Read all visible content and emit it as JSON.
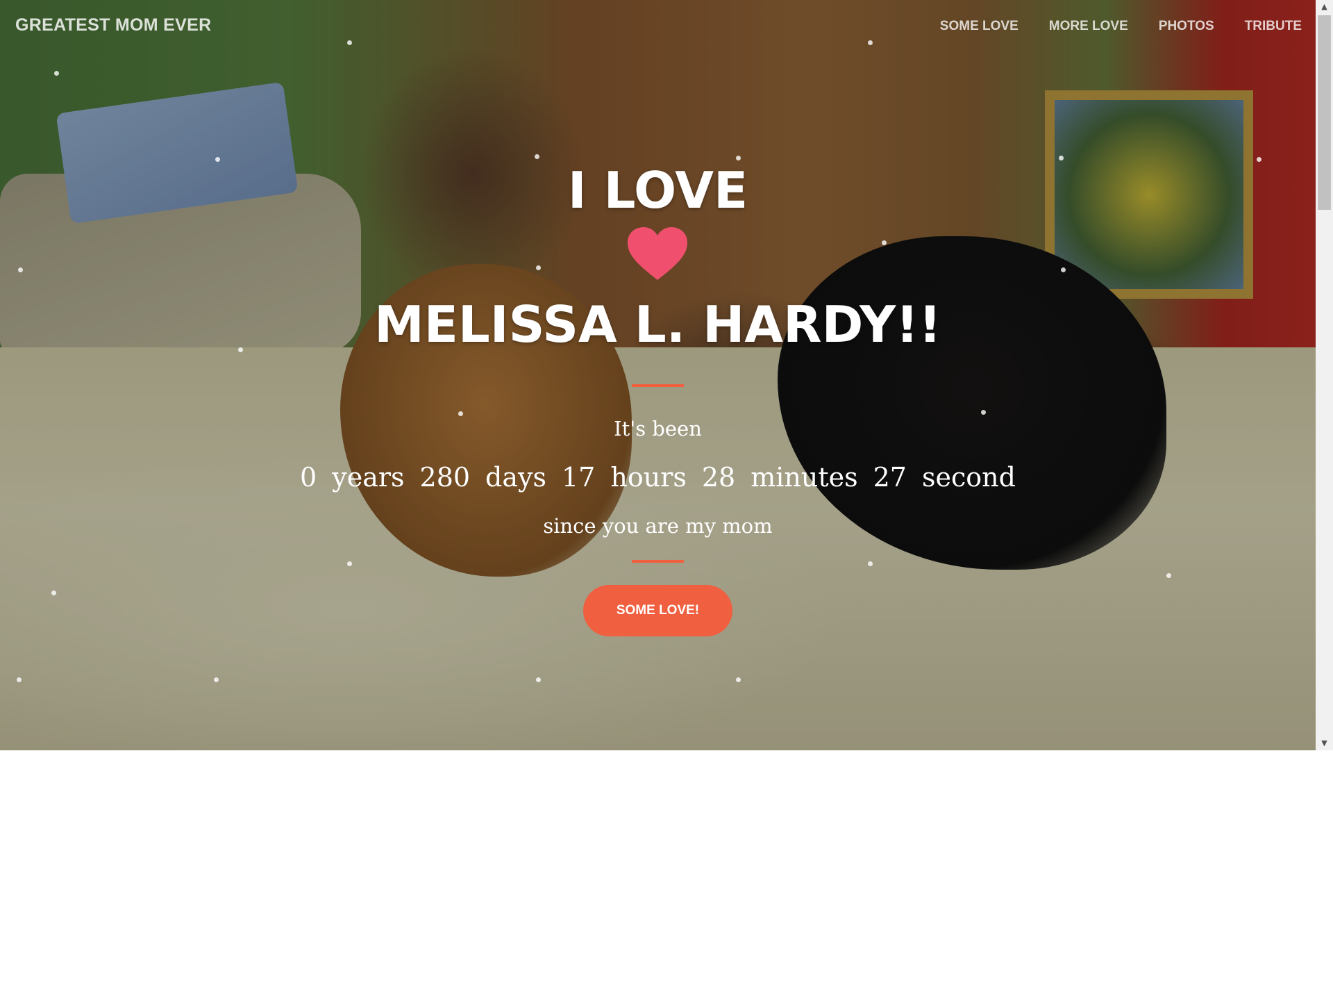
{
  "navbar": {
    "brand": "GREATEST MOM EVER",
    "links": [
      "SOME LOVE",
      "MORE LOVE",
      "PHOTOS",
      "TRIBUTE"
    ]
  },
  "hero": {
    "heading_top": "I LOVE",
    "heading_name": "MELISSA L. HARDY!!",
    "heart_icon": "heart-icon",
    "intro": "It's been",
    "counter": [
      {
        "value": "0",
        "unit": "years"
      },
      {
        "value": "280",
        "unit": "days"
      },
      {
        "value": "17",
        "unit": "hours"
      },
      {
        "value": "28",
        "unit": "minutes"
      },
      {
        "value": "27",
        "unit": "second"
      }
    ],
    "outro": "since you are my mom",
    "cta_label": "SOME LOVE!"
  },
  "colors": {
    "accent": "#f05f40",
    "heart": "#f0506e"
  }
}
